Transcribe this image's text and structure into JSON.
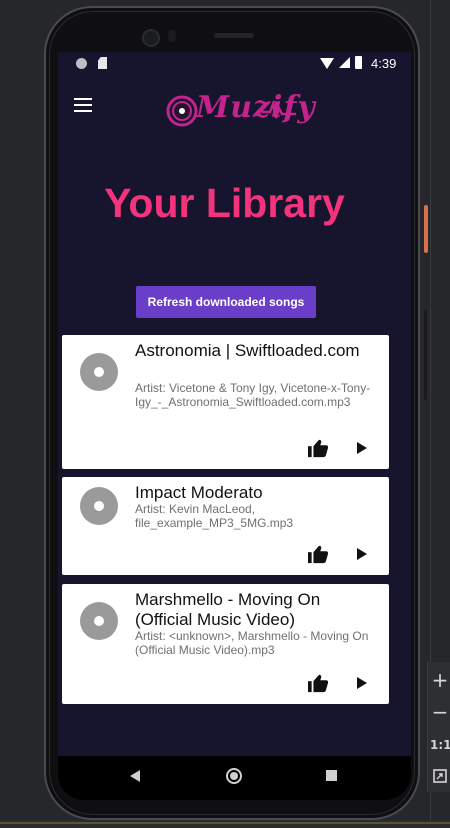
{
  "status_bar": {
    "time": "4:39"
  },
  "header": {
    "logo_text": "Muzify"
  },
  "page": {
    "title": "Your Library",
    "refresh_button": "Refresh downloaded songs"
  },
  "songs": [
    {
      "title": "Astronomia | Swiftloaded.com",
      "artist": "Artist: Vicetone & Tony Igy, Vicetone-x-Tony-Igy_-_Astronomia_Swiftloaded.com.mp3"
    },
    {
      "title": "Impact Moderato",
      "artist": "Artist: Kevin MacLeod, file_example_MP3_5MG.mp3"
    },
    {
      "title": "Marshmello - Moving On (Official Music Video)",
      "artist": "Artist: <unknown>, Marshmello - Moving On (Official Music Video).mp3"
    }
  ],
  "emulator": {
    "zoom_in": "+",
    "zoom_out": "−",
    "ratio": "1:1"
  },
  "colors": {
    "accent": "#f4337d",
    "button": "#6a3ec8",
    "background": "#16152d",
    "logo": "#c2238c"
  },
  "icons": [
    "menu-icon",
    "thumbs-up-icon",
    "play-icon",
    "disc-icon",
    "back-icon",
    "home-icon",
    "recents-icon"
  ]
}
